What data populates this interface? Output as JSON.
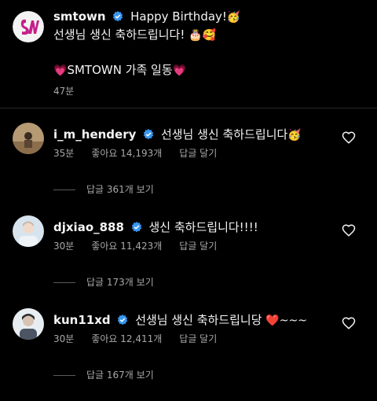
{
  "post": {
    "username": "smtown",
    "text_line1": "Happy Birthday!",
    "emoji1": "🥳",
    "text_line2": "선생님 생신 축하드립니다!",
    "emoji2": "🎂🥰",
    "text_line3_emoji_left": "💗",
    "text_line3": "SMTOWN 가족 일동",
    "text_line3_emoji_right": "💗",
    "time": "47분"
  },
  "comments": [
    {
      "username": "i_m_hendery",
      "text": "선생님 생신 축하드립니다",
      "emoji": "🥳",
      "time": "35분",
      "likes": "좋아요 14,193개",
      "reply": "답글 달기",
      "replies": "답글 361개 보기"
    },
    {
      "username": "djxiao_888",
      "text": "생신 축하드립니다!!!!",
      "emoji": "",
      "time": "30분",
      "likes": "좋아요 11,423개",
      "reply": "답글 달기",
      "replies": "답글 173개 보기"
    },
    {
      "username": "kun11xd",
      "text": "선생님 생신 축하드립니당",
      "emoji": "❤️~~~",
      "time": "30분",
      "likes": "좋아요 12,411개",
      "reply": "답글 달기",
      "replies": "답글 167개 보기"
    }
  ],
  "colors": {
    "verified": "#3897f0",
    "muted": "#a8a8a8",
    "background": "#000000"
  }
}
